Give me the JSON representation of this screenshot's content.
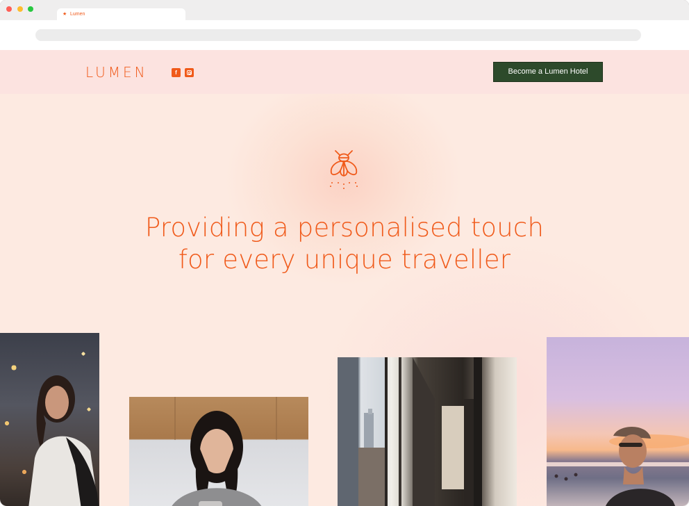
{
  "browser": {
    "tab_title": "Lumen",
    "tab_icon": "lumen-bug-icon"
  },
  "header": {
    "logo": "LUMEN",
    "social": [
      {
        "name": "facebook-icon",
        "glyph": "f"
      },
      {
        "name": "instagram-icon"
      }
    ],
    "cta_label": "Become a Lumen Hotel"
  },
  "hero": {
    "icon": "firefly-icon",
    "headline_line1": "Providing a personalised touch",
    "headline_line2": "for every unique traveller"
  },
  "photos": [
    {
      "name": "photo-woman-city-night"
    },
    {
      "name": "photo-woman-phone"
    },
    {
      "name": "photo-hotel-corridor"
    },
    {
      "name": "photo-man-beach-sunset"
    }
  ],
  "colors": {
    "brand_orange": "#f05a1a",
    "header_bg": "#fce3e0",
    "hero_bg": "#fdeae1",
    "cta_bg": "#2d4a2b"
  }
}
